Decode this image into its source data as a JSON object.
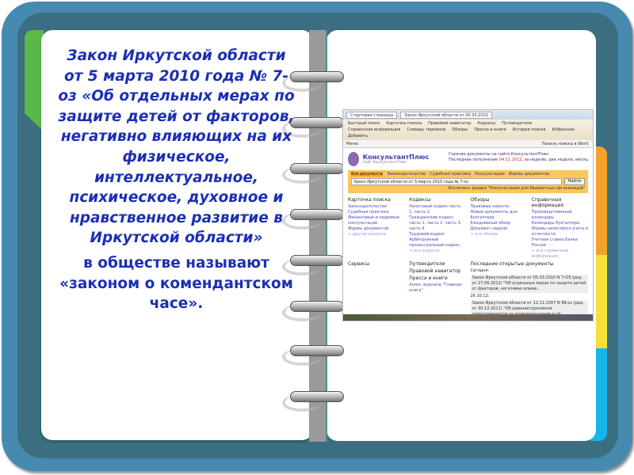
{
  "left_page": {
    "law_text": "Закон Иркутской области от 5 марта 2010 года № 7-оз «Об отдельных мерах по защите детей от факторов, негативно влияющих на их физическое, интеллектуальное, психическое, духовное и нравственное развитие в Иркутской области»",
    "nickname_text": "в обществе называют «законом о комендантском часе»."
  },
  "screenshot": {
    "window_tab_1": "Стартовая страница",
    "window_tab_2": "Закон Иркутской области от 05.03.2010",
    "toolbar": [
      "Быстрый поиск",
      "Карточка поиска",
      "Правовой навигатор",
      "Кодексы",
      "Путеводители",
      "Справочная информация",
      "Словарь терминов",
      "Обзоры",
      "Пресса и книги",
      "История поиска",
      "Избранное",
      "Добавить"
    ],
    "nav_left": "Меню",
    "nav_right": "Панель поиска в Word",
    "brand": "КонсультантПлюс",
    "brand_sub": "Сайт КонсультантПлюс",
    "news_1": "Горячие документы на сайте КонсультантПлюс",
    "news_2_prefix": "Последнее пополнение",
    "news_2_date": "04.11.2012",
    "news_2_suffix": ", за неделю, две недели, месяц",
    "search_tabs": [
      "Все документы",
      "Законодательство",
      "Судебная практика",
      "Консультации",
      "Формы документов"
    ],
    "search_value": "Закон Иркутской области от 5 марта 2010 года № 7-оз",
    "search_button": "Найти",
    "search_checkbox": "Исключить раздел \"Консультации для бюджетных организаций\"",
    "columns": [
      {
        "title": "Карточка поиска",
        "items": [
          "Законодательство",
          "Судебная практика",
          "Финансовые и кадровые консультации",
          "Формы документов"
        ],
        "more": "+ другие разделы"
      },
      {
        "title": "Кодексы",
        "items": [
          "Налоговый кодекс часть 1, часть 2",
          "Гражданский кодекс часть 1, часть 2, часть 3, часть 4",
          "Трудовой кодекс",
          "Арбитражный процессуальный кодекс"
        ],
        "more": "+ все кодексы"
      },
      {
        "title": "Обзоры",
        "items": [
          "Правовые новости",
          "Новые документы для бухгалтера",
          "Ежедневный обзор",
          "Документ недели"
        ],
        "more": "+ все обзоры"
      },
      {
        "title": "Справочная информация",
        "items": [
          "Производственный календарь",
          "Календарь бухгалтера",
          "Формы налогового учета и отчетности",
          "Учетная ставка Банка России"
        ],
        "more": "+ вся справочная информация"
      }
    ],
    "services": "Сервисы",
    "guides": "Путеводители",
    "navigator": "Правовой навигатор",
    "press": "Пресса и книги",
    "press_item": "Анонс журнала \"Главная книга\"",
    "recent_title": "Последние открытые документы",
    "recent_today": "Сегодня:",
    "recent_doc_1": "Закон Иркутской области от 05.03.2010 N 7-ОЗ (ред. от 27.06.2012) \"Об отдельных мерах по защите детей от факторов, негативно влияю...",
    "recent_day_2": "26.10.12:",
    "recent_doc_2": "Закон Иркутской области от 12.11.2007 N 98-оз (ред. от 30.12.2011) \"Об административной ответственности за правонарушения в сф..."
  }
}
